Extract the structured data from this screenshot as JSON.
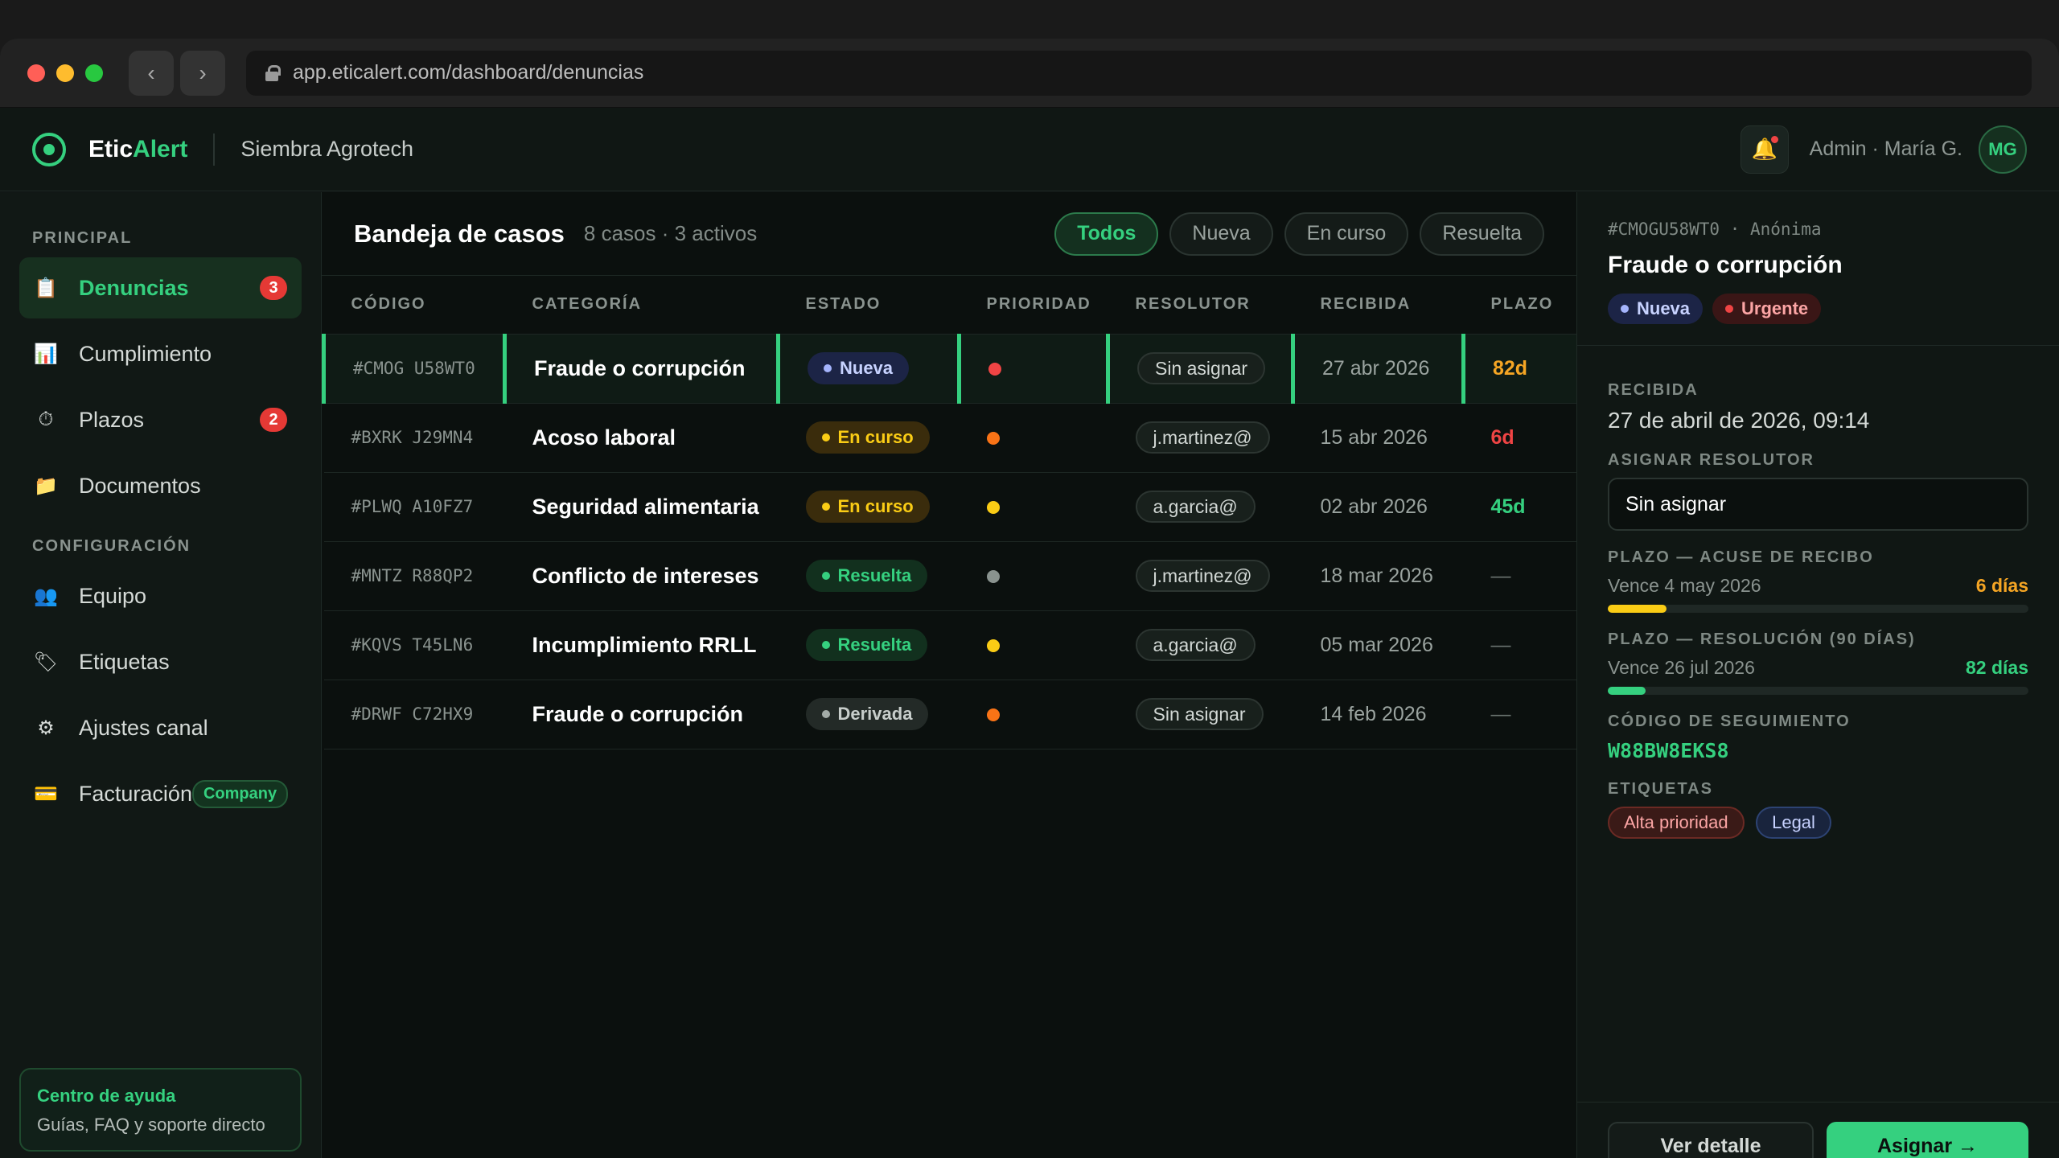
{
  "browser": {
    "url": "app.eticalert.com/dashboard/denuncias",
    "back": "‹",
    "forward": "›"
  },
  "header": {
    "brand_a": "Etic",
    "brand_b": "Alert",
    "org": "Siembra Agrotech",
    "user": "Admin · María G.",
    "initials": "MG",
    "bell": "🔔"
  },
  "sidebar": {
    "sec_principal": "PRINCIPAL",
    "sec_config": "CONFIGURACIÓN",
    "items": [
      {
        "label": "Denuncias",
        "icon": "📋",
        "badge": "3"
      },
      {
        "label": "Cumplimiento",
        "icon": "📊"
      },
      {
        "label": "Plazos",
        "icon": "⏱",
        "badge": "2"
      },
      {
        "label": "Documentos",
        "icon": "📁"
      },
      {
        "label": "Equipo",
        "icon": "👥"
      },
      {
        "label": "Etiquetas",
        "icon": "🏷"
      },
      {
        "label": "Ajustes canal",
        "icon": "⚙"
      },
      {
        "label": "Facturación",
        "icon": "💳",
        "tag": "Company"
      }
    ],
    "help_title": "Centro de ayuda",
    "help_sub": "Guías, FAQ y soporte directo"
  },
  "main": {
    "title": "Bandeja de casos",
    "subtitle": "8 casos · 3 activos",
    "filters": [
      "Todos",
      "Nueva",
      "En curso",
      "Resuelta"
    ],
    "columns": [
      "CÓDIGO",
      "CATEGORÍA",
      "ESTADO",
      "PRIORIDAD",
      "RESOLUTOR",
      "RECIBIDA",
      "PLAZO"
    ],
    "rows": [
      {
        "code": "#CMOG U58WT0",
        "cat": "Fraude o corrupción",
        "status": "Nueva",
        "resolver": "Sin asignar",
        "date": "27 abr 2026",
        "plazo": "82d"
      },
      {
        "code": "#BXRK J29MN4",
        "cat": "Acoso laboral",
        "status": "En curso",
        "resolver": "j.martinez@",
        "date": "15 abr 2026",
        "plazo": "6d"
      },
      {
        "code": "#PLWQ A10FZ7",
        "cat": "Seguridad alimentaria",
        "status": "En curso",
        "resolver": "a.garcia@",
        "date": "02 abr 2026",
        "plazo": "45d"
      },
      {
        "code": "#MNTZ R88QP2",
        "cat": "Conflicto de intereses",
        "status": "Resuelta",
        "resolver": "j.martinez@",
        "date": "18 mar 2026",
        "plazo": "—"
      },
      {
        "code": "#KQVS T45LN6",
        "cat": "Incumplimiento RRLL",
        "status": "Resuelta",
        "resolver": "a.garcia@",
        "date": "05 mar 2026",
        "plazo": "—"
      },
      {
        "code": "#DRWF C72HX9",
        "cat": "Fraude o corrupción",
        "status": "Derivada",
        "resolver": "Sin asignar",
        "date": "14 feb 2026",
        "plazo": "—"
      }
    ]
  },
  "panel": {
    "id": "#CMOGU58WT0 · Anónima",
    "title": "Fraude o corrupción",
    "tag_status": "Nueva",
    "tag_priority": "Urgente",
    "lbl_received": "RECIBIDA",
    "received": "27 de abril de 2026, 09:14",
    "lbl_assign": "ASIGNAR RESOLUTOR",
    "assign_value": "Sin asignar",
    "lbl_ack": "PLAZO — ACUSE DE RECIBO",
    "ack_due": "Vence 4 may 2026",
    "ack_left": "6 días",
    "ack_progress": 0.14,
    "lbl_res": "PLAZO — RESOLUCIÓN (90 DÍAS)",
    "res_due": "Vence 26 jul 2026",
    "res_left": "82 días",
    "res_progress": 0.09,
    "lbl_track": "CÓDIGO DE SEGUIMIENTO",
    "track": "W88BW8EKS8",
    "lbl_tags": "ETIQUETAS",
    "tags": [
      "Alta prioridad",
      "Legal"
    ],
    "btn_detail": "Ver detalle",
    "btn_assign": "Asignar →"
  },
  "colors": {
    "accent": "#35d07f",
    "urgent": "#ef4444",
    "warn": "#f5a524",
    "orange": "#f97316",
    "yellow": "#facc15"
  }
}
